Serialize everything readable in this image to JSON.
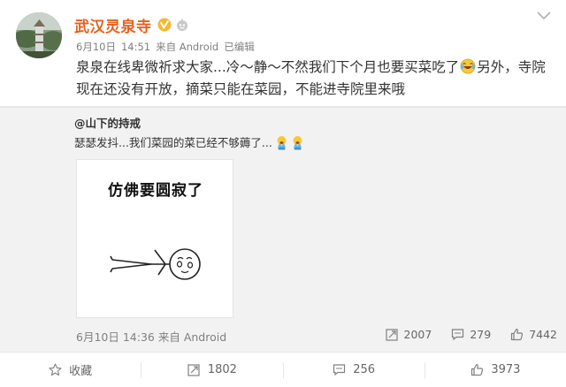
{
  "author": {
    "name": "武汉灵泉寺",
    "avatar": "temple-avatar"
  },
  "meta": {
    "date": "6月10日",
    "time": "14:51",
    "source": "来自 Android",
    "edited": "已编辑"
  },
  "post": {
    "text_part1": "泉泉在线卑微祈求大家...冷～静～不然我们下个月也要买菜吃了",
    "emoji": "laughing-tears-emoji",
    "text_part2": "另外，寺院现在还没有开放，摘菜只能在菜园，不能进寺院里来哦"
  },
  "repost": {
    "author": "@山下的持戒",
    "text": "瑟瑟发抖...我们菜园的菜已经不够薅了...",
    "emoji": "crying-emoji",
    "image": {
      "caption": "仿佛要圆寂了"
    },
    "date": "6月10日",
    "time": "14:36",
    "source": "来自 Android",
    "actions": {
      "repost_count": "2007",
      "comment_count": "279",
      "like_count": "7442"
    }
  },
  "footer": {
    "favorite_label": "收藏",
    "repost_count": "1802",
    "comment_count": "256",
    "like_count": "3973"
  },
  "colors": {
    "author_name": "#e8601f",
    "verified": "#f6b830",
    "repost_background": "#f2f2f2",
    "muted_text": "#808080"
  }
}
